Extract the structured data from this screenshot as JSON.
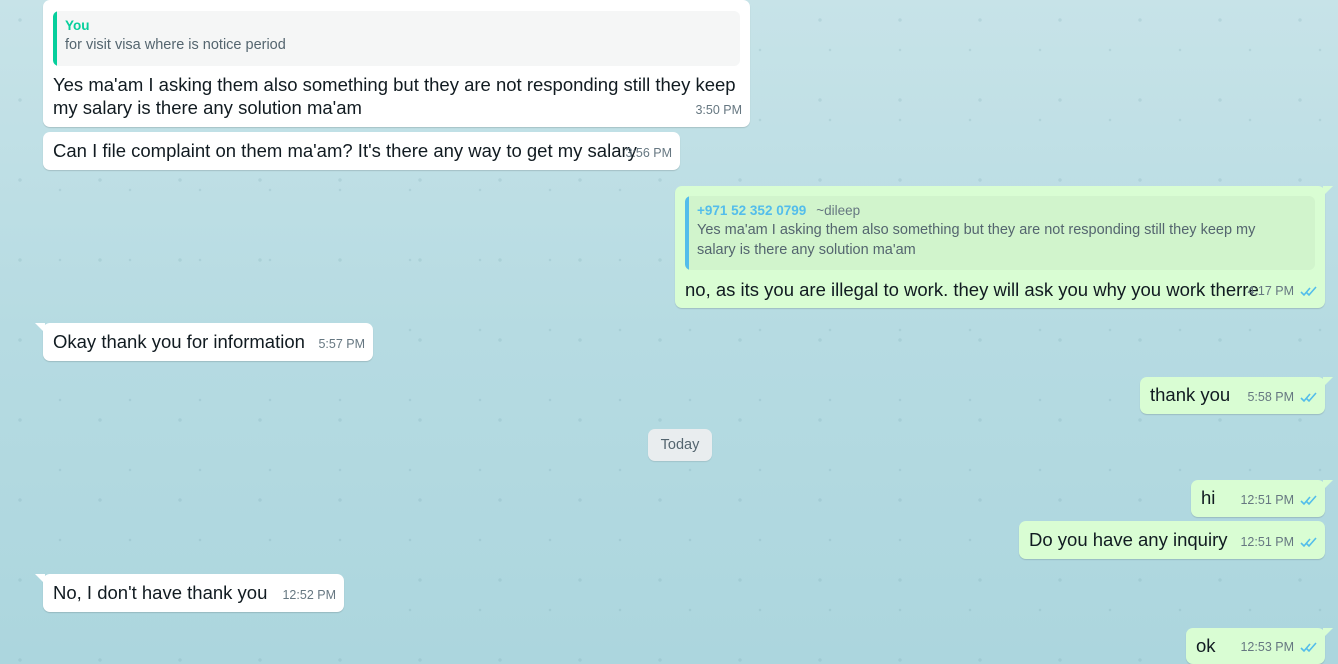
{
  "messages": [
    {
      "direction": "incoming",
      "quote": {
        "author": "You",
        "text": "for visit visa where is notice period"
      },
      "text": "Yes ma'am I asking them also something but they are not responding still they keep my salary is there any solution ma'am",
      "time": "3:50 PM"
    },
    {
      "direction": "incoming",
      "text": "Can I file complaint on them ma'am? It's there any way to get my salary",
      "time": "3:56 PM"
    },
    {
      "direction": "outgoing",
      "quote": {
        "author": "+971 52 352 0799",
        "handle": "~dileep",
        "text": "Yes ma'am I asking them also something but they are not responding still they keep my salary is there any solution ma'am"
      },
      "text": "no, as its you are illegal to work. they will ask you why you work therre",
      "time": "4:17 PM",
      "status": "read"
    },
    {
      "direction": "incoming",
      "text": "Okay thank you for information",
      "time": "5:57 PM"
    },
    {
      "direction": "outgoing",
      "text": "thank you",
      "time": "5:58 PM",
      "status": "read"
    },
    {
      "direction": "outgoing",
      "text": "hi",
      "time": "12:51 PM",
      "status": "read"
    },
    {
      "direction": "outgoing",
      "text": "Do you have any inquiry",
      "time": "12:51 PM",
      "status": "read"
    },
    {
      "direction": "incoming",
      "text": "No, I don't have thank you",
      "time": "12:52 PM"
    },
    {
      "direction": "outgoing",
      "text": "ok",
      "time": "12:53 PM",
      "status": "read"
    }
  ],
  "date_divider": "Today",
  "colors": {
    "incoming_bubble": "#ffffff",
    "outgoing_bubble": "#d9fdd3",
    "quote_you_bar": "#06cf9c",
    "quote_contact_bar": "#53bdeb",
    "read_ticks": "#53bdeb",
    "timestamp": "#667781"
  },
  "icons": {
    "read_status": "double-check-icon"
  }
}
